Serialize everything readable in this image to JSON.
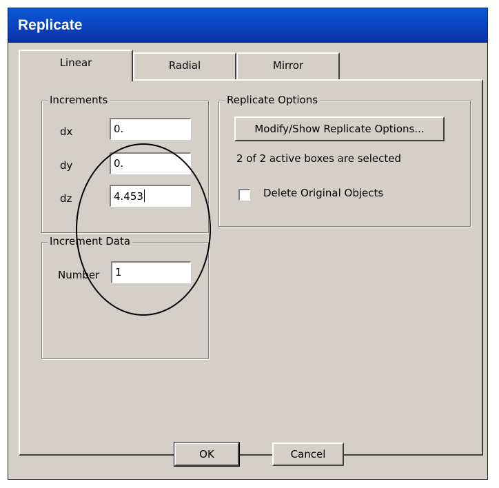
{
  "window": {
    "title": "Replicate"
  },
  "tabs": [
    {
      "label": "Linear",
      "active": true
    },
    {
      "label": "Radial",
      "active": false
    },
    {
      "label": "Mirror",
      "active": false
    }
  ],
  "increments": {
    "legend": "Increments",
    "dx": {
      "label": "dx",
      "value": "0."
    },
    "dy": {
      "label": "dy",
      "value": "0."
    },
    "dz": {
      "label": "dz",
      "value": "4.453"
    }
  },
  "increment_data": {
    "legend": "Increment Data",
    "number": {
      "label": "Number",
      "value": "1"
    }
  },
  "replicate_options": {
    "legend": "Replicate Options",
    "modify_button": "Modify/Show Replicate Options...",
    "status": "2 of 2 active boxes are selected",
    "delete_original": {
      "label": "Delete Original Objects",
      "checked": false
    }
  },
  "buttons": {
    "ok": "OK",
    "cancel": "Cancel"
  }
}
